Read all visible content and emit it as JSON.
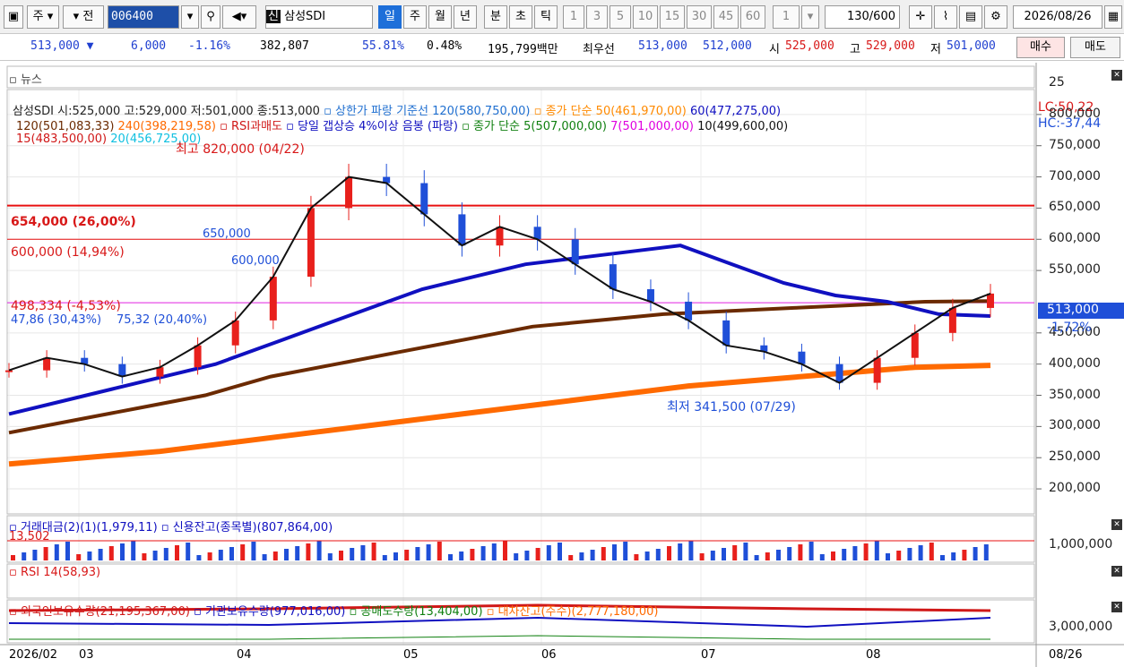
{
  "toolbar": {
    "period": "주",
    "prev": "전",
    "code": "006400",
    "stock_name": "삼성SDI",
    "credit_badge": "신",
    "timeframes": [
      "일",
      "주",
      "월",
      "년",
      "분",
      "초",
      "틱"
    ],
    "intervals": [
      "1",
      "3",
      "5",
      "10",
      "15",
      "30",
      "45",
      "60"
    ],
    "unit_value": "1",
    "count": "130",
    "count_total": "/600",
    "date": "2026/08/26"
  },
  "quote": {
    "price": "513,000",
    "direction": "▼",
    "change": "6,000",
    "change_pct": "-1.16%",
    "volume": "382,807",
    "vol_ratio": "55.81%",
    "turnover": "0.48%",
    "amount": "195,799백만",
    "best_label": "최우선",
    "best_ask": "513,000",
    "best_bid": "512,000",
    "open_label": "시",
    "open": "525,000",
    "high_label": "고",
    "high": "529,000",
    "low_label": "저",
    "low": "501,000",
    "buy": "매수",
    "sell": "매도"
  },
  "panels": {
    "news": "뉴스",
    "news_axis": "25",
    "rsi_title": "RSI 14(58,93)",
    "amount_axis": "1,000,000",
    "holding_axis": "3,000,000",
    "lc": "LC:50,22",
    "hc": "HC:-37,44",
    "current_price": "513,000",
    "current_pct": "-1,72%"
  },
  "legend1": [
    {
      "text": "삼성SDI 시:525,000 고:529,000 저:501,000 종:513,000",
      "color": "#222222"
    },
    {
      "text": "▫ 상한가 파랑  기준선 120(580,750,00)",
      "color": "#1f6fd0"
    },
    {
      "text": "▫ 종가 단순 50(461,970,00)",
      "color": "#ff8a00"
    },
    {
      "text": "60(477,275,00)",
      "color": "#1010c0"
    }
  ],
  "legend2": [
    {
      "text": "120(501,083,33)",
      "color": "#6b2a00"
    },
    {
      "text": "240(398,219,58)",
      "color": "#ff6a00"
    },
    {
      "text": "▫ RSI과매도",
      "color": "#d01818"
    },
    {
      "text": "▫ 당일 갭상승 4%이상 음봉 (파랑)",
      "color": "#1010c0"
    },
    {
      "text": "▫ 종가 단순 5(507,000,00)",
      "color": "#108010"
    },
    {
      "text": "7(501,000,00)",
      "color": "#e000e0"
    },
    {
      "text": "10(499,600,00)",
      "color": "#111111"
    }
  ],
  "legend3": [
    {
      "text": "15(483,500,00)",
      "color": "#d01818"
    },
    {
      "text": "20(456,725,00)",
      "color": "#10c0e0"
    }
  ],
  "annotations": {
    "high_note": "최고 820,000 (04/22)",
    "low_note": "최저 341,500 (07/29)",
    "line_654": "654,000 (26,00%)",
    "line_600": "600,000 (14,94%)",
    "line_498": "498,334 (-4,53%)",
    "label_47": "47,86 (30,43%)",
    "label_75": "75,32 (20,40%)",
    "trend_650": "650,000",
    "trend_600": "600,000"
  },
  "amount_legend": [
    {
      "text": "▫ 거래대금(2)(1)(1,979,11)",
      "color": "#1010c0"
    },
    {
      "text": "▫ 신용잔고(종목별)(807,864,00)",
      "color": "#1010c0"
    }
  ],
  "amount_overlay": "13,502",
  "holding_legend": [
    {
      "text": "▫ 외국인보유수량(21,195,367,00)",
      "color": "#d01818"
    },
    {
      "text": "▫ 기관보유수량(977,016,00)",
      "color": "#1010c0"
    },
    {
      "text": "▫ 공매도수량(13,404,00)",
      "color": "#108010"
    },
    {
      "text": "▫ 대차잔고(주수)(2,777,180,00)",
      "color": "#ff6a00"
    }
  ],
  "yaxis": [
    "800,000",
    "750,000",
    "700,000",
    "650,000",
    "600,000",
    "550,000",
    "450,000",
    "400,000",
    "350,000",
    "300,000",
    "250,000",
    "200,000"
  ],
  "xaxis": [
    "2026/02",
    "03",
    "04",
    "05",
    "06",
    "07",
    "08"
  ],
  "xaxis_right": "08/26",
  "colors": {
    "up": "#e8201c",
    "down": "#1f4fd8",
    "hline": "#e81010",
    "hline_pink": "#e020e0"
  },
  "chart_data": {
    "type": "candlestick",
    "ylim": [
      180000,
      840000
    ],
    "grid": true,
    "series": [
      {
        "name": "삼성SDI",
        "close": [
          390000,
          410000,
          400000,
          380000,
          395000,
          430000,
          470000,
          540000,
          650000,
          700000,
          690000,
          640000,
          590000,
          620000,
          600000,
          560000,
          520000,
          500000,
          470000,
          430000,
          420000,
          400000,
          370000,
          410000,
          450000,
          490000,
          513000
        ]
      },
      {
        "name": "60",
        "values": [
          320000,
          340000,
          360000,
          380000,
          400000,
          430000,
          460000,
          490000,
          520000,
          540000,
          560000,
          570000,
          580000,
          590000,
          560000,
          530000,
          510000,
          500000,
          480000,
          477000
        ]
      },
      {
        "name": "120",
        "values": [
          290000,
          310000,
          330000,
          350000,
          380000,
          400000,
          420000,
          440000,
          460000,
          470000,
          480000,
          485000,
          490000,
          495000,
          500000,
          501000
        ]
      },
      {
        "name": "240",
        "values": [
          240000,
          250000,
          260000,
          275000,
          290000,
          305000,
          320000,
          335000,
          350000,
          365000,
          375000,
          385000,
          395000,
          398000
        ]
      }
    ]
  }
}
